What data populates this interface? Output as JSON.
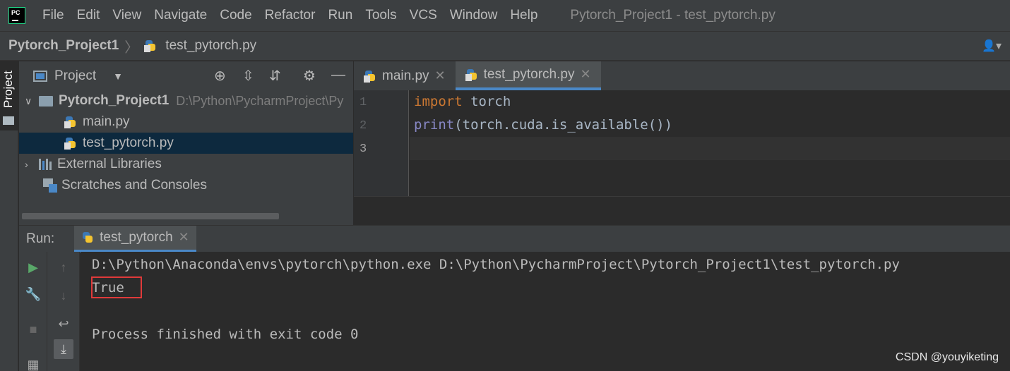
{
  "menubar": {
    "items": [
      "File",
      "Edit",
      "View",
      "Navigate",
      "Code",
      "Refactor",
      "Run",
      "Tools",
      "VCS",
      "Window",
      "Help"
    ],
    "window_title": "Pytorch_Project1 - test_pytorch.py"
  },
  "breadcrumb": {
    "project": "Pytorch_Project1",
    "file": "test_pytorch.py"
  },
  "left_strip": {
    "project_tab": "Project"
  },
  "project_panel": {
    "header": "Project",
    "tree": {
      "root_name": "Pytorch_Project1",
      "root_path": "D:\\Python\\PycharmProject\\Py",
      "files": [
        "main.py",
        "test_pytorch.py"
      ],
      "external_libraries": "External Libraries",
      "scratches": "Scratches and Consoles"
    }
  },
  "editor": {
    "tabs": [
      "main.py",
      "test_pytorch.py"
    ],
    "active_tab": "test_pytorch.py",
    "line_numbers": [
      "1",
      "2",
      "3"
    ],
    "code": {
      "line1_kw": "import",
      "line1_rest": " torch",
      "line2_builtin": "print",
      "line2_rest": "(torch.cuda.is_available())"
    }
  },
  "run_panel": {
    "label": "Run:",
    "tab": "test_pytorch",
    "output": [
      "D:\\Python\\Anaconda\\envs\\pytorch\\python.exe D:\\Python\\PycharmProject\\Pytorch_Project1\\test_pytorch.py",
      "True",
      "Process finished with exit code 0"
    ]
  },
  "watermark": "CSDN @youyiketing",
  "colors": {
    "accent": "#4a88c7",
    "keyword": "#cc7832",
    "builtin": "#8888c6",
    "highlight_box": "#e03a3a"
  }
}
